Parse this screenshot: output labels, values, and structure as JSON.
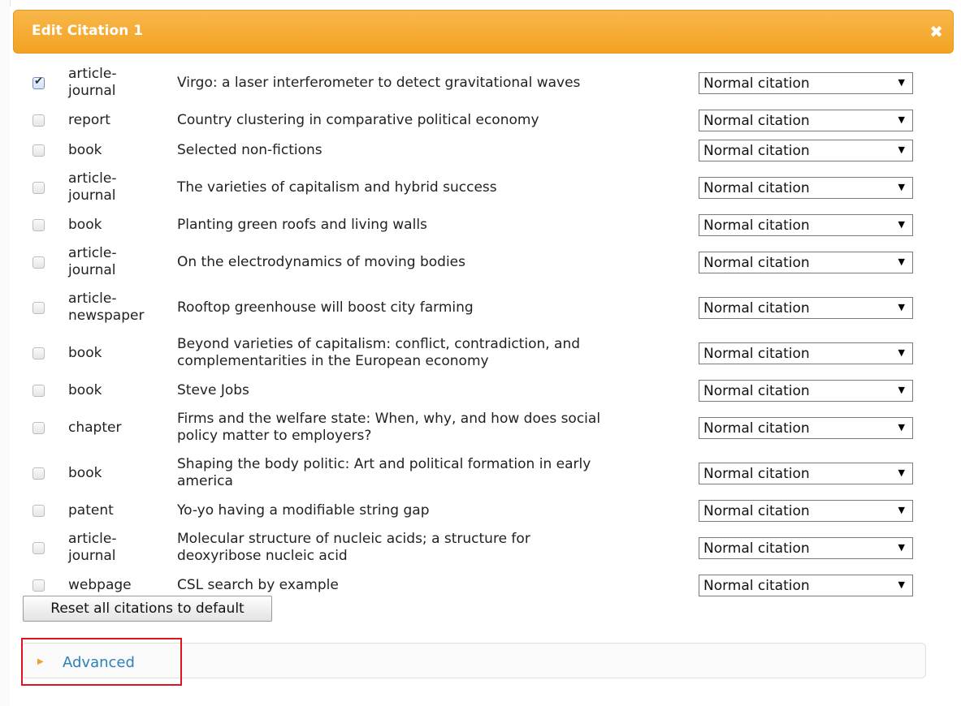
{
  "dialog": {
    "title": "Edit Citation 1",
    "close_glyph": "✖",
    "dropdown_arrow": "▼",
    "check_glyph": "✔"
  },
  "citations": [
    {
      "checked": true,
      "type_line1": "article-",
      "type_line2": "journal",
      "title_line1": "Virgo: a laser interferometer to detect gravitational waves",
      "title_line2": "",
      "mode": "Normal citation"
    },
    {
      "checked": false,
      "type_line1": "report",
      "type_line2": "",
      "title_line1": "Country clustering in comparative political economy",
      "title_line2": "",
      "mode": "Normal citation"
    },
    {
      "checked": false,
      "type_line1": "book",
      "type_line2": "",
      "title_line1": "Selected non-fictions",
      "title_line2": "",
      "mode": "Normal citation"
    },
    {
      "checked": false,
      "type_line1": "article-",
      "type_line2": "journal",
      "title_line1": "The varieties of capitalism and hybrid success",
      "title_line2": "",
      "mode": "Normal citation"
    },
    {
      "checked": false,
      "type_line1": "book",
      "type_line2": "",
      "title_line1": "Planting green roofs and living walls",
      "title_line2": "",
      "mode": "Normal citation"
    },
    {
      "checked": false,
      "type_line1": "article-",
      "type_line2": "journal",
      "title_line1": "On the electrodynamics of moving bodies",
      "title_line2": "",
      "mode": "Normal citation"
    },
    {
      "checked": false,
      "type_line1": "article-",
      "type_line2": "newspaper",
      "title_line1": "Rooftop greenhouse will boost city farming",
      "title_line2": "",
      "mode": "Normal citation"
    },
    {
      "checked": false,
      "type_line1": "book",
      "type_line2": "",
      "title_line1": "Beyond varieties of capitalism: conflict, contradiction, and",
      "title_line2": "complementarities in the European economy",
      "mode": "Normal citation"
    },
    {
      "checked": false,
      "type_line1": "book",
      "type_line2": "",
      "title_line1": "Steve Jobs",
      "title_line2": "",
      "mode": "Normal citation"
    },
    {
      "checked": false,
      "type_line1": "chapter",
      "type_line2": "",
      "title_line1": "Firms and the welfare state: When, why, and how does social",
      "title_line2": "policy matter to employers?",
      "mode": "Normal citation"
    },
    {
      "checked": false,
      "type_line1": "book",
      "type_line2": "",
      "title_line1": "Shaping the body politic: Art and political formation in early",
      "title_line2": "america",
      "mode": "Normal citation"
    },
    {
      "checked": false,
      "type_line1": "patent",
      "type_line2": "",
      "title_line1": "Yo-yo having a modifiable string gap",
      "title_line2": "",
      "mode": "Normal citation"
    },
    {
      "checked": false,
      "type_line1": "article-",
      "type_line2": "journal",
      "title_line1": "Molecular structure of nucleic acids; a structure for",
      "title_line2": "deoxyribose nucleic acid",
      "mode": "Normal citation"
    },
    {
      "checked": false,
      "type_line1": "webpage",
      "type_line2": "",
      "title_line1": "CSL search by example",
      "title_line2": "",
      "mode": "Normal citation"
    }
  ],
  "reset_button_label": "Reset all citations to default",
  "advanced": {
    "label": "Advanced",
    "arrow_glyph": "▶"
  },
  "highlight_color": "#e0141e",
  "accent_color": "#f3a223"
}
